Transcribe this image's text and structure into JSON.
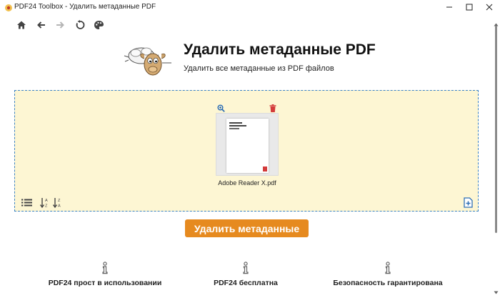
{
  "window": {
    "title": "PDF24 Toolbox - Удалить метаданные PDF"
  },
  "header": {
    "title": "Удалить метаданные PDF",
    "subtitle": "Удалить все метаданные из PDF файлов"
  },
  "toolbar": {
    "icons": [
      "home-icon",
      "arrow-left-icon",
      "arrow-right-icon",
      "refresh-icon",
      "palette-icon"
    ]
  },
  "dropzone": {
    "files": [
      {
        "name": "Adobe Reader X.pdf"
      }
    ]
  },
  "action": {
    "label": "Удалить метаданные"
  },
  "features": [
    {
      "label": "PDF24 прост в использовании"
    },
    {
      "label": "PDF24 бесплатна"
    },
    {
      "label": "Безопасность гарантирована"
    }
  ],
  "colors": {
    "accent": "#e68a1f",
    "dropzone_bg": "#fdf6d3",
    "dropzone_border": "#3b82c4",
    "icon_blue": "#2f6fb5",
    "delete_red": "#d33b3b"
  }
}
